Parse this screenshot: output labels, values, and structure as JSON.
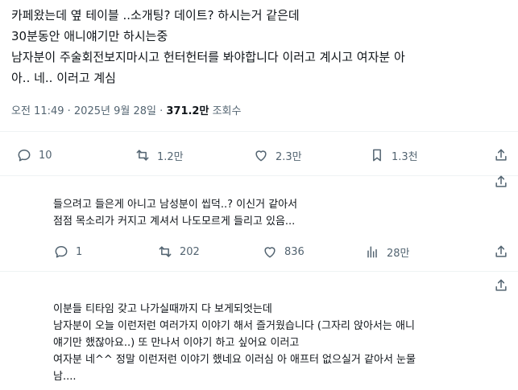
{
  "post": {
    "lines": [
      "카페왔는데 옆 테이블 ..소개팅? 데이트? 하시는거 같은데",
      "30분동안 애니얘기만 하시는중",
      "남자분이 주술회전보지마시고 헌터헌터를 봐야합니다 이러고 계시고 여자분 아",
      "아.. 네.. 이러고 계심"
    ],
    "time": "오전 11:49 · 2025년 9월 28일 · ",
    "views": "371.2만",
    "views_label": " 조회수",
    "actions": {
      "replies": "10",
      "reposts": "1.2만",
      "likes": "2.3만",
      "bookmarks": "1.3천"
    }
  },
  "reply1": {
    "lines": [
      "들으려고 들은게 아니고 남성분이 씹덕..? 이신거 같아서",
      "점점 목소리가 커지고 계셔서 나도모르게 들리고 있음..."
    ],
    "actions": {
      "replies": "1",
      "reposts": "202",
      "likes": "836",
      "views": "28만"
    }
  },
  "reply2": {
    "lines": [
      "이분들 티타임 갖고 나가실때까지 다 보게되엇는데",
      "남자분이 오늘 이런저런 여러가지 이야기 해서 즐거웠습니다 (그자리 앉아서는 애니",
      "얘기만 했잖아요..) 또 만나서 이야기 하고 싶어요 이러고",
      "여자분 네^^ 정말 이런저런 이야기 했네요  이러심 아 애프터 없으실거 같아서 눈물",
      "남...."
    ]
  }
}
